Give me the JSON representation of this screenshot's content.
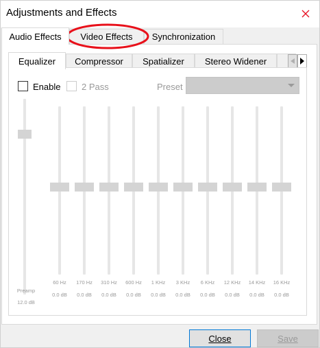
{
  "window": {
    "title": "Adjustments and Effects"
  },
  "main_tabs": [
    {
      "label": "Audio Effects",
      "active": true
    },
    {
      "label": "Video Effects",
      "active": false
    },
    {
      "label": "Synchronization",
      "active": false
    }
  ],
  "sub_tabs": [
    {
      "label": "Equalizer",
      "active": true
    },
    {
      "label": "Compressor",
      "active": false
    },
    {
      "label": "Spatializer",
      "active": false
    },
    {
      "label": "Stereo Widener",
      "active": false
    }
  ],
  "equalizer": {
    "enable_label": "Enable",
    "enable_checked": false,
    "two_pass_label": "2 Pass",
    "two_pass_checked": false,
    "preset_label": "Preset",
    "preset_value": "",
    "preamp": {
      "label": "Preamp",
      "value": "12.0 dB",
      "level": 0.8
    },
    "bands": [
      {
        "freq": "60 Hz",
        "value": "0.0 dB",
        "level": 0.5
      },
      {
        "freq": "170 Hz",
        "value": "0.0 dB",
        "level": 0.5
      },
      {
        "freq": "310 Hz",
        "value": "0.0 dB",
        "level": 0.5
      },
      {
        "freq": "600 Hz",
        "value": "0.0 dB",
        "level": 0.5
      },
      {
        "freq": "1 KHz",
        "value": "0.0 dB",
        "level": 0.5
      },
      {
        "freq": "3 KHz",
        "value": "0.0 dB",
        "level": 0.5
      },
      {
        "freq": "6 KHz",
        "value": "0.0 dB",
        "level": 0.5
      },
      {
        "freq": "12 KHz",
        "value": "0.0 dB",
        "level": 0.5
      },
      {
        "freq": "14 KHz",
        "value": "0.0 dB",
        "level": 0.5
      },
      {
        "freq": "16 KHz",
        "value": "0.0 dB",
        "level": 0.5
      }
    ]
  },
  "buttons": {
    "close_label": "Close",
    "save_label": "Save"
  },
  "annotation": {
    "color": "#e8101a"
  }
}
